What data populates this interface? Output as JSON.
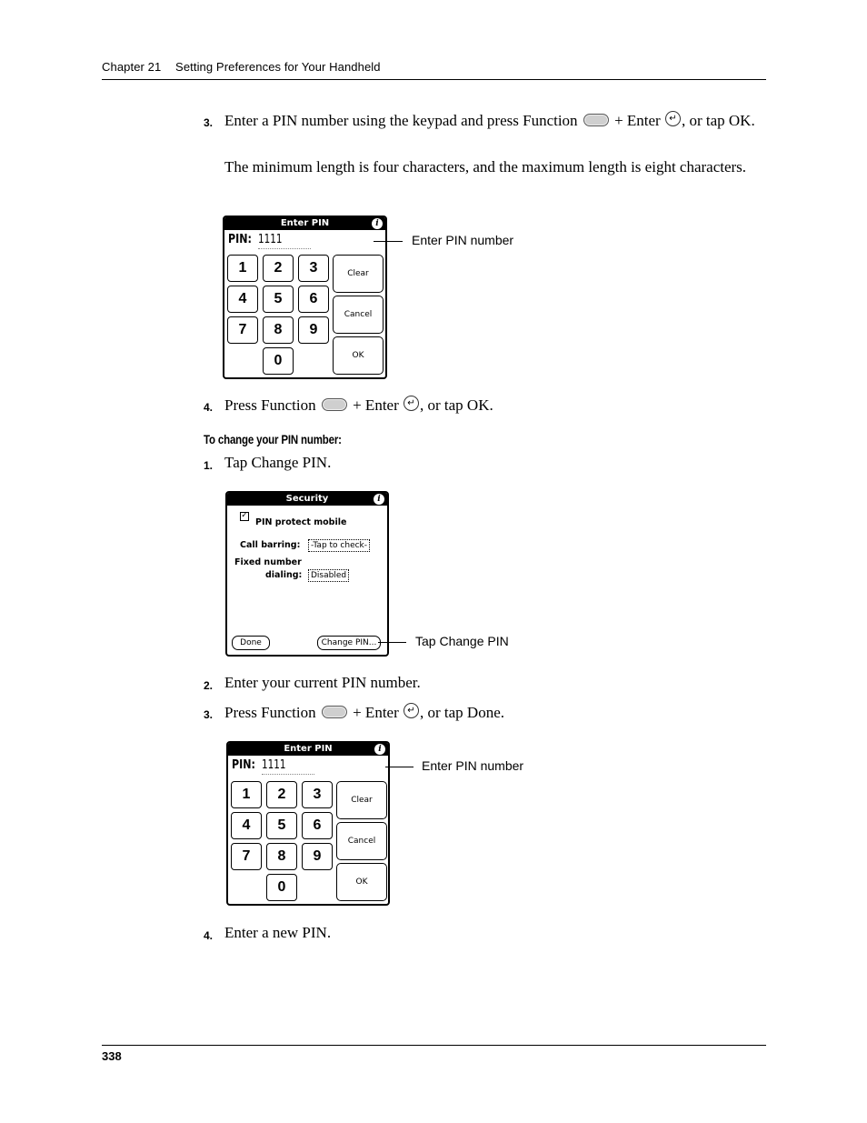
{
  "header": {
    "chapter": "Chapter 21",
    "title": "Setting Preferences for Your Handheld"
  },
  "section1": {
    "step3": {
      "num": "3.",
      "text_a": "Enter a PIN number using the keypad and press Function",
      "text_b": "+ Enter",
      "text_c": ", or tap OK.",
      "note": "The minimum length is four characters, and the maximum length is eight characters."
    },
    "step4": {
      "num": "4.",
      "text_a": "Press Function",
      "text_b": "+ Enter",
      "text_c": ", or tap OK."
    }
  },
  "enter_pin_screen": {
    "title": "Enter PIN",
    "info_icon": "i",
    "pin_label": "PIN:",
    "pin_value": "1111",
    "keys": [
      "1",
      "2",
      "3",
      "4",
      "5",
      "6",
      "7",
      "8",
      "9",
      "0"
    ],
    "clear": "Clear",
    "cancel": "Cancel",
    "ok": "OK",
    "callout": "Enter PIN number"
  },
  "subhead": "To change your PIN number:",
  "section2": {
    "step1": {
      "num": "1.",
      "text": "Tap Change PIN."
    },
    "step2": {
      "num": "2.",
      "text": "Enter your current PIN number."
    },
    "step3": {
      "num": "3.",
      "text_a": "Press Function",
      "text_b": "+ Enter",
      "text_c": ", or tap Done."
    },
    "step4": {
      "num": "4.",
      "text": "Enter a new PIN."
    }
  },
  "security_screen": {
    "title": "Security",
    "info_icon": "i",
    "checkbox_mark": "✓",
    "pin_protect": "PIN protect mobile",
    "pin_protect_checked": true,
    "call_barring_label": "Call barring:",
    "call_barring_value": "-Tap to check-",
    "fixed_label_1": "Fixed number",
    "fixed_label_2": "dialing:",
    "fixed_value": "Disabled",
    "done": "Done",
    "change_pin": "Change PIN...",
    "callout": "Tap Change PIN"
  },
  "icons": {
    "function_key": "function-key-icon",
    "enter_key": "↵"
  },
  "footer": {
    "page_number": "338"
  }
}
